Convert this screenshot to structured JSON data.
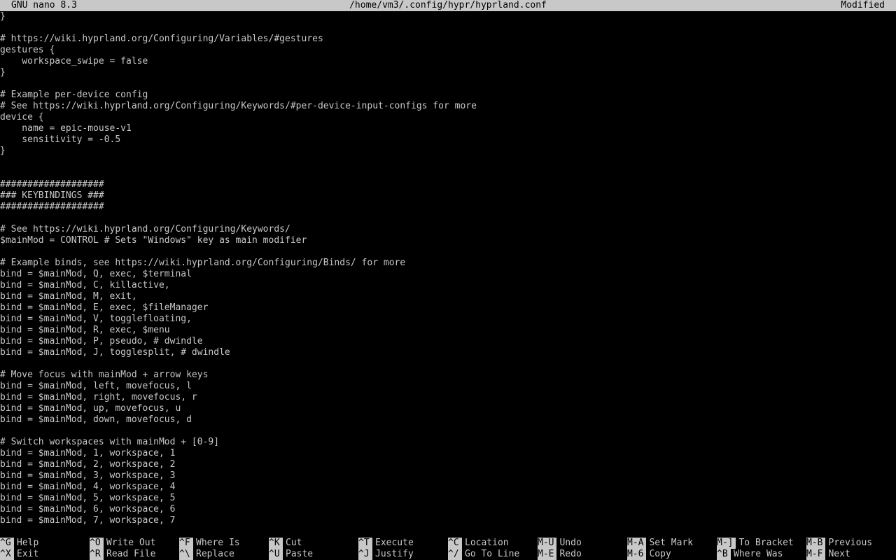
{
  "titlebar": {
    "app": "GNU nano 8.3",
    "file": "/home/vm3/.config/hypr/hyprland.conf",
    "status": "Modified"
  },
  "editor": {
    "lines": [
      "}",
      "",
      "# https://wiki.hyprland.org/Configuring/Variables/#gestures",
      "gestures {",
      "    workspace_swipe = false",
      "}",
      "",
      "# Example per-device config",
      "# See https://wiki.hyprland.org/Configuring/Keywords/#per-device-input-configs for more",
      "device {",
      "    name = epic-mouse-v1",
      "    sensitivity = -0.5",
      "}",
      "",
      "",
      "###################",
      "### KEYBINDINGS ###",
      "###################",
      "",
      "# See https://wiki.hyprland.org/Configuring/Keywords/",
      "$mainMod = CONTROL # Sets \"Windows\" key as main modifier",
      "",
      "# Example binds, see https://wiki.hyprland.org/Configuring/Binds/ for more",
      "bind = $mainMod, Q, exec, $terminal",
      "bind = $mainMod, C, killactive,",
      "bind = $mainMod, M, exit,",
      "bind = $mainMod, E, exec, $fileManager",
      "bind = $mainMod, V, togglefloating,",
      "bind = $mainMod, R, exec, $menu",
      "bind = $mainMod, P, pseudo, # dwindle",
      "bind = $mainMod, J, togglesplit, # dwindle",
      "",
      "# Move focus with mainMod + arrow keys",
      "bind = $mainMod, left, movefocus, l",
      "bind = $mainMod, right, movefocus, r",
      "bind = $mainMod, up, movefocus, u",
      "bind = $mainMod, down, movefocus, d",
      "",
      "# Switch workspaces with mainMod + [0-9]",
      "bind = $mainMod, 1, workspace, 1",
      "bind = $mainMod, 2, workspace, 2",
      "bind = $mainMod, 3, workspace, 3",
      "bind = $mainMod, 4, workspace, 4",
      "bind = $mainMod, 5, workspace, 5",
      "bind = $mainMod, 6, workspace, 6",
      "bind = $mainMod, 7, workspace, 7"
    ]
  },
  "shortcuts": {
    "row1": [
      {
        "key": "^G",
        "label": "Help"
      },
      {
        "key": "^O",
        "label": "Write Out"
      },
      {
        "key": "^F",
        "label": "Where Is"
      },
      {
        "key": "^K",
        "label": "Cut"
      },
      {
        "key": "^T",
        "label": "Execute"
      },
      {
        "key": "^C",
        "label": "Location"
      },
      {
        "key": "M-U",
        "label": "Undo"
      },
      {
        "key": "M-A",
        "label": "Set Mark"
      },
      {
        "key": "M-]",
        "label": "To Bracket"
      },
      {
        "key": "M-B",
        "label": "Previous"
      }
    ],
    "row2": [
      {
        "key": "^X",
        "label": "Exit"
      },
      {
        "key": "^R",
        "label": "Read File"
      },
      {
        "key": "^\\",
        "label": "Replace"
      },
      {
        "key": "^U",
        "label": "Paste"
      },
      {
        "key": "^J",
        "label": "Justify"
      },
      {
        "key": "^/",
        "label": "Go To Line"
      },
      {
        "key": "M-E",
        "label": "Redo"
      },
      {
        "key": "M-6",
        "label": "Copy"
      },
      {
        "key": "^B",
        "label": "Where Was"
      },
      {
        "key": "M-F",
        "label": "Next"
      }
    ]
  },
  "colors": {
    "background": "#000000",
    "foreground": "#c8c8c8",
    "inverse_bg": "#c8c8c8",
    "inverse_fg": "#000000"
  }
}
